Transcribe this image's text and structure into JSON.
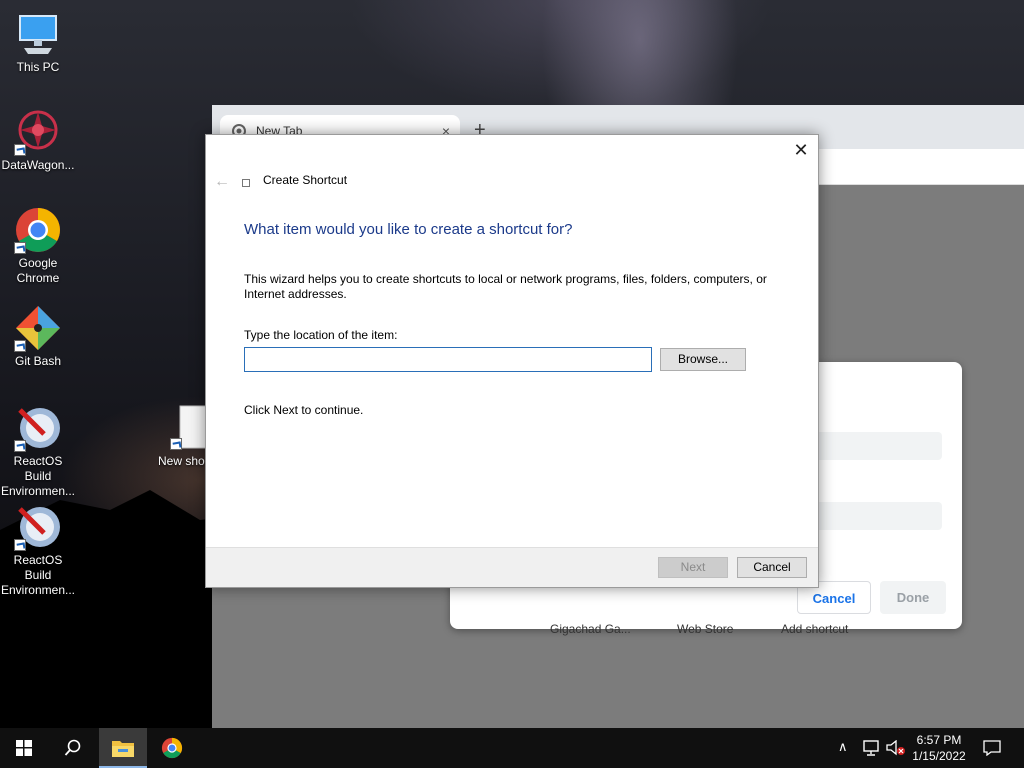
{
  "desktop": {
    "icons": [
      {
        "label": "This PC"
      },
      {
        "label": "DataWagon..."
      },
      {
        "label": "Google Chrome"
      },
      {
        "label": "Git Bash"
      },
      {
        "label": "ReactOS Build Environmen..."
      },
      {
        "label": "ReactOS Build Environmen..."
      },
      {
        "label": "New sho"
      }
    ]
  },
  "browser": {
    "tab_title": "New Tab",
    "new_tab_symbol": "+",
    "tab_close_symbol": "×",
    "dialog": {
      "cancel_label": "Cancel",
      "done_label": "Done",
      "shortcut_labels": [
        "Gigachad Ga...",
        "Web Store",
        "Add shortcut"
      ]
    }
  },
  "wizard": {
    "window_title": "Create Shortcut",
    "close_symbol": "✕",
    "back_symbol": "←",
    "heading": "What item would you like to create a shortcut for?",
    "description": "This wizard helps you to create shortcuts to local or network programs, files, folders, computers, or Internet addresses.",
    "location_label": "Type the location of the item:",
    "location_value": "",
    "browse_label": "Browse...",
    "continue_text": "Click Next to continue.",
    "next_label": "Next",
    "cancel_label": "Cancel"
  },
  "taskbar": {
    "time": "6:57 PM",
    "date": "1/15/2022",
    "tray_chevron": "∧"
  }
}
